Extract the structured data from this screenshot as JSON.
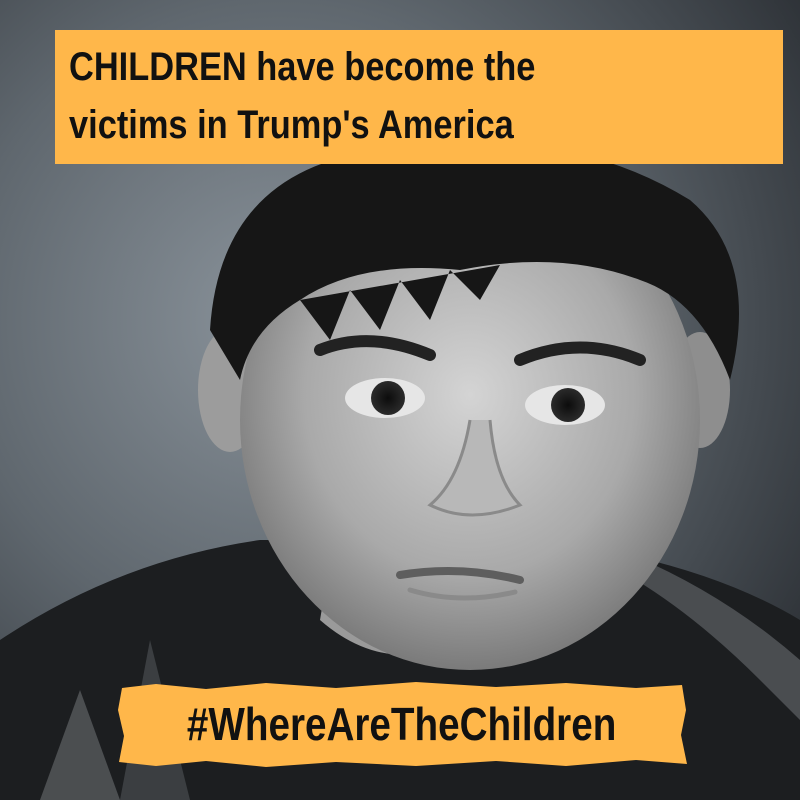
{
  "headline": {
    "line1": "CHILDREN have become the",
    "line2": "victims in Trump's America"
  },
  "hashtag": "#WhereAreTheChildren",
  "colors": {
    "accent": "#ffb74a",
    "text": "#111111"
  }
}
